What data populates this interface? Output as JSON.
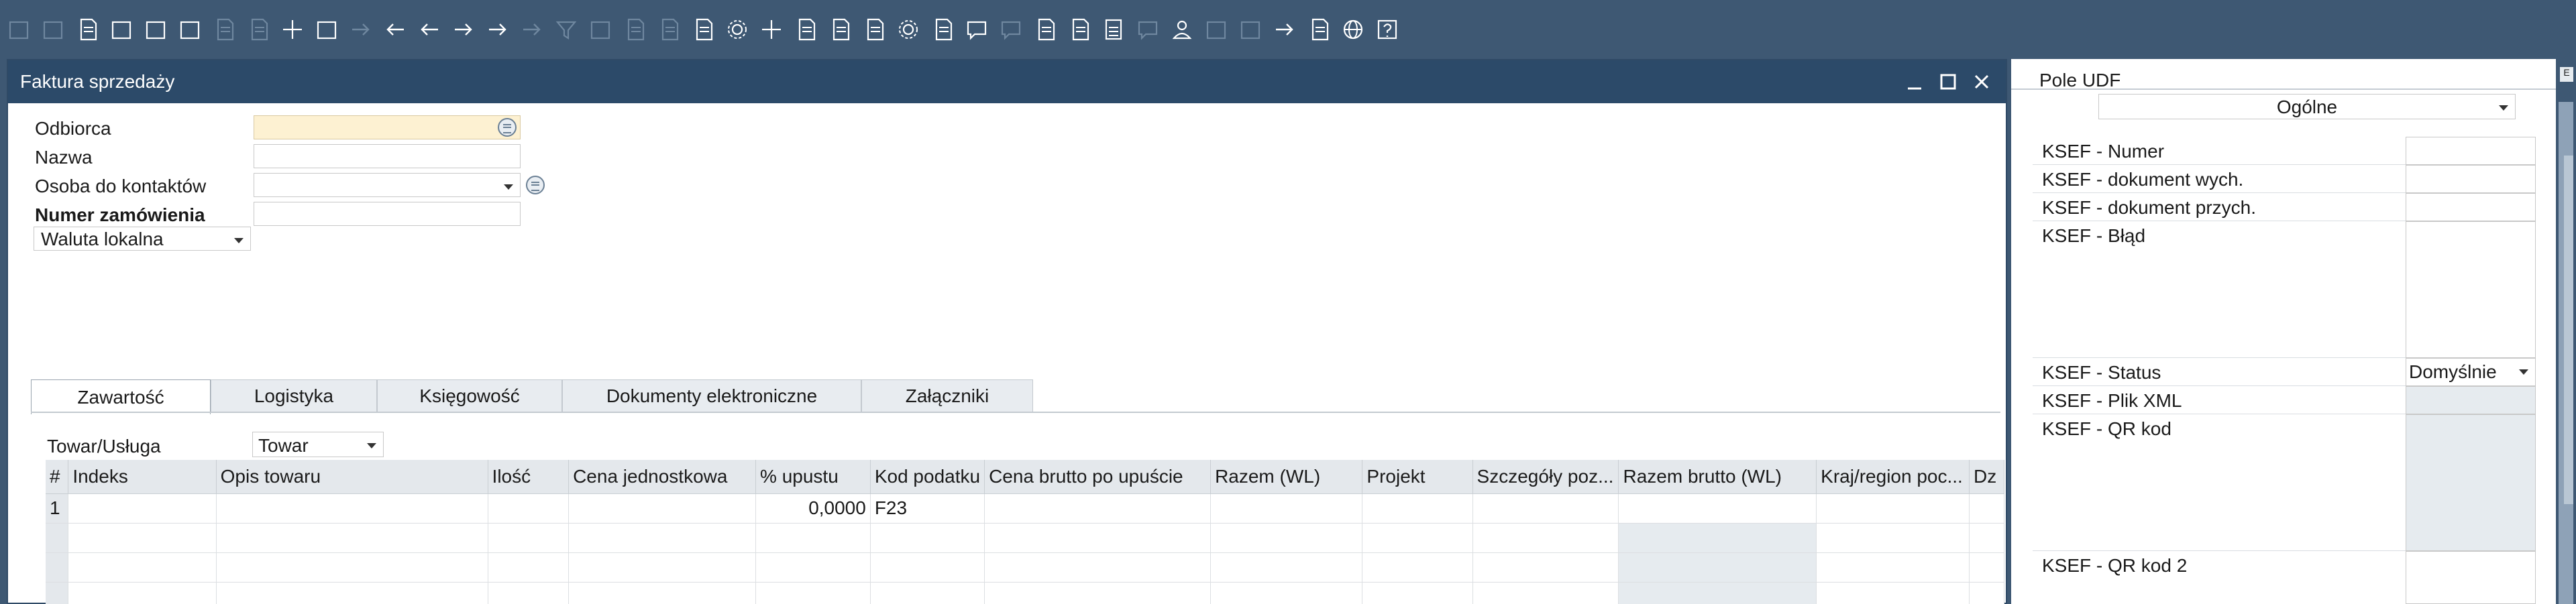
{
  "toolbar": {
    "icons": [
      "print-preview-icon",
      "print-icon",
      "folder-icon",
      "email-icon",
      "export-icon",
      "excel-icon",
      "word-icon",
      "pdf-icon",
      "move-icon",
      "binoculars-icon",
      "goto-icon",
      "first-record-icon",
      "previous-record-icon",
      "next-record-icon",
      "last-record-icon",
      "refresh-icon",
      "filter-icon",
      "sort-icon",
      "base-document-icon",
      "target-document-icon",
      "payment-icon",
      "currency-icon",
      "balance-icon",
      "document-icon",
      "query-icon",
      "edit-icon",
      "settings-icon",
      "form-settings-icon",
      "message-icon",
      "alert-icon",
      "approval-icon",
      "info-icon",
      "calculator-icon",
      "chat-icon",
      "user-icon",
      "link-icon",
      "layout-icon",
      "export-data-icon",
      "report-icon",
      "web-icon",
      "help-icon"
    ]
  },
  "window": {
    "title": "Faktura sprzedaży"
  },
  "form": {
    "customer_label": "Odbiorca",
    "customer_value": "",
    "name_label": "Nazwa",
    "name_value": "",
    "contact_label": "Osoba do kontaktów",
    "contact_value": "",
    "order_label": "Numer zamówienia",
    "order_value": "",
    "currency_value": "Waluta lokalna"
  },
  "tabs": [
    {
      "label": "Zawartość",
      "active": true
    },
    {
      "label": "Logistyka",
      "active": false
    },
    {
      "label": "Księgowość",
      "active": false
    },
    {
      "label": "Dokumenty elektroniczne",
      "active": false
    },
    {
      "label": "Załączniki",
      "active": false
    }
  ],
  "item_type": {
    "label": "Towar/Usługa",
    "value": "Towar"
  },
  "grid": {
    "columns": [
      "#",
      "Indeks",
      "Opis towaru",
      "Ilość",
      "Cena jednostkowa",
      "% upustu",
      "Kod podatku",
      "Cena brutto po upuście",
      "Razem (WL)",
      "Projekt",
      "Szczegóły poz...",
      "Razem brutto (WL)",
      "Kraj/region poc...",
      "Dz"
    ],
    "rows": [
      [
        "1",
        "",
        "",
        "",
        "",
        "0,0000",
        "F23",
        "",
        "",
        "",
        "",
        "",
        "",
        ""
      ],
      [
        "",
        "",
        "",
        "",
        "",
        "",
        "",
        "",
        "",
        "",
        "",
        "",
        "",
        ""
      ],
      [
        "",
        "",
        "",
        "",
        "",
        "",
        "",
        "",
        "",
        "",
        "",
        "",
        "",
        ""
      ],
      [
        "",
        "",
        "",
        "",
        "",
        "",
        "",
        "",
        "",
        "",
        "",
        "",
        "",
        ""
      ]
    ]
  },
  "udf": {
    "title": "Pole UDF",
    "category": "Ogólne",
    "fields": [
      {
        "label": "KSEF - Numer",
        "value": ""
      },
      {
        "label": "KSEF - dokument wych.",
        "value": ""
      },
      {
        "label": "KSEF - dokument przych.",
        "value": ""
      },
      {
        "label": "KSEF - Błąd",
        "value": ""
      },
      {
        "label": "KSEF - Status",
        "value": "Domyślnie"
      },
      {
        "label": "KSEF - Plik XML",
        "value": ""
      },
      {
        "label": "KSEF -  QR kod",
        "value": ""
      },
      {
        "label": "KSEF -  QR kod 2",
        "value": ""
      }
    ]
  },
  "strip": {
    "tab_label": "E"
  }
}
